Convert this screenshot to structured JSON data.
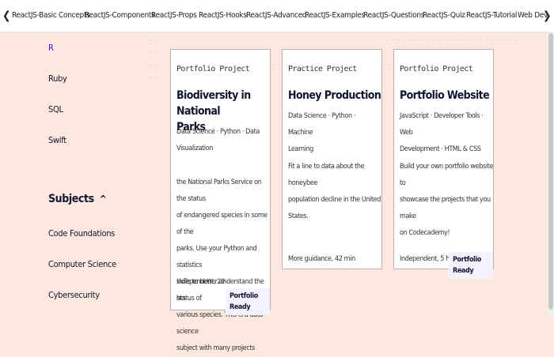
{
  "tabs": {
    "prev_arrow": "❮",
    "next_arrow": "❯",
    "items": [
      {
        "label": "ReactJS-Basic Concepts"
      },
      {
        "label": "ReactJS-Components"
      },
      {
        "label": "ReactJS-Props"
      },
      {
        "label": "ReactJS-Hooks"
      },
      {
        "label": "ReactJS-Advanced"
      },
      {
        "label": "ReactJS-Examples"
      },
      {
        "label": "ReactJS-Questions"
      },
      {
        "label": "ReactJS-Quiz"
      },
      {
        "label": "ReactJS-Tutorial"
      },
      {
        "label": "Web Dev"
      }
    ]
  },
  "sidebar": {
    "languages": [
      {
        "label": "R"
      },
      {
        "label": "Ruby"
      },
      {
        "label": "SQL"
      },
      {
        "label": "Swift"
      }
    ],
    "subjects_heading": "Subjects",
    "subjects_caret": "^",
    "subjects": [
      {
        "label": "Code Foundations"
      },
      {
        "label": "Computer Science"
      },
      {
        "label": "Cybersecurity"
      }
    ]
  },
  "cards": [
    {
      "kind": "Portfolio Project",
      "title_lines": [
        "Biodiversity in National",
        "Parks"
      ],
      "tag_lines": [
        "Data Science · Python · Data",
        "Visualization"
      ],
      "desc_lines": [
        "the National Parks Service on the status",
        "of endangered species in some of the",
        "parks. Use your Python and statistics",
        "skills to better understand the status of",
        "various species. This is a data science",
        "subject with many projects"
      ],
      "meta_lines": [
        "Independent, 20",
        "hrs"
      ],
      "badge": "Portfolio Ready"
    },
    {
      "kind": "Practice Project",
      "title_lines": [
        "Honey Production"
      ],
      "tag_lines": [
        "Data Science · Python · Machine",
        "Learning"
      ],
      "desc_lines": [
        "Fit a line to data about the honeybee",
        "population decline in the United States."
      ],
      "meta_lines": [
        "More guidance, 42 min"
      ]
    },
    {
      "kind": "Portfolio Project",
      "title_lines": [
        "Portfolio Website"
      ],
      "tag_lines": [
        "JavaScript · Developer Tools · Web",
        "Development · HTML & CSS"
      ],
      "desc_lines": [
        "Build your own portfolio website to",
        "showcase the projects that you make",
        "on Codecademy!"
      ],
      "meta_lines": [
        "Independent, 5 hrs"
      ],
      "badge": "Portfolio Ready"
    }
  ],
  "colors": {
    "page_background": "#fde8df",
    "accent_link": "#3a10e5",
    "badge_background": "#f5f2ff"
  }
}
